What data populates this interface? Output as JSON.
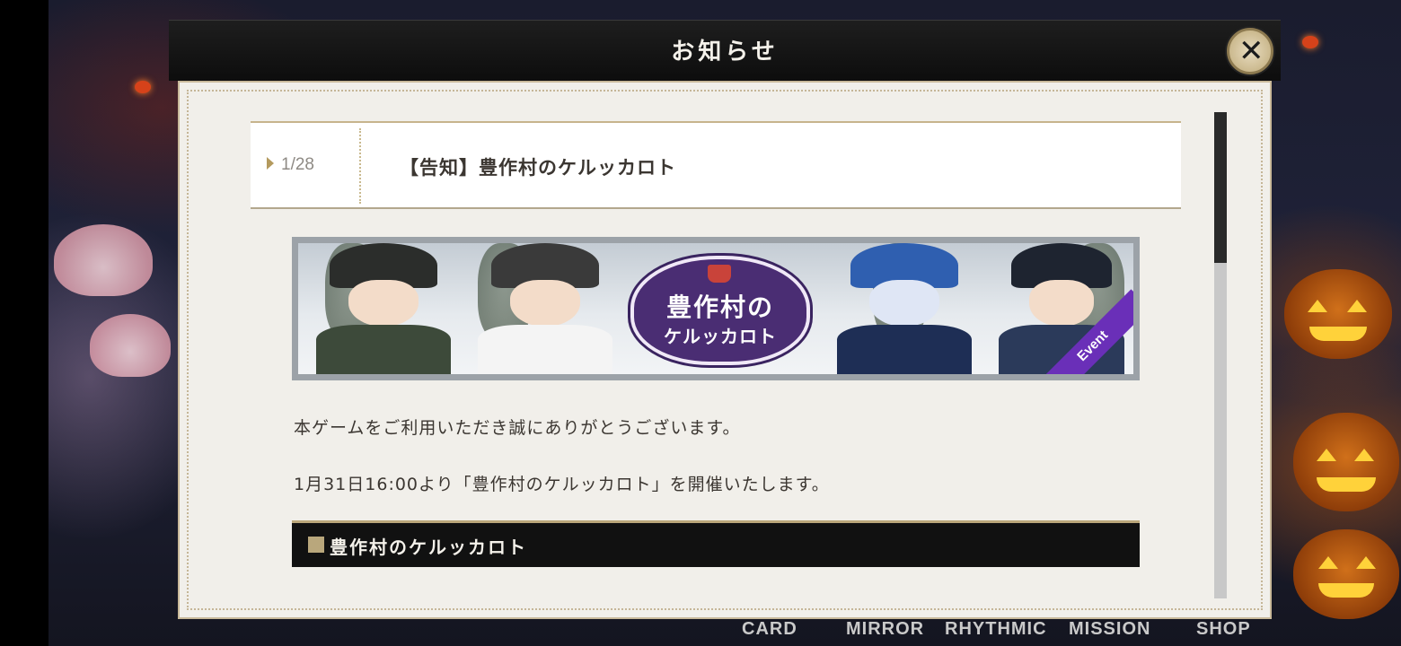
{
  "modal": {
    "title": "お知らせ",
    "close_icon": "close-icon"
  },
  "notice": {
    "date": "1/28",
    "title": "【告知】豊作村のケルッカロト"
  },
  "banner": {
    "logo_line1": "豊作村の",
    "logo_line2": "ケルッカロト",
    "ribbon": "Event"
  },
  "body": {
    "paragraph1": "本ゲームをご利用いただき誠にありがとうございます。",
    "paragraph2": "1月31日16:00より「豊作村のケルッカロト」を開催いたします。",
    "section_title": "豊作村のケルッカロト"
  },
  "bottom_nav": {
    "items": [
      "CARD",
      "MIRROR",
      "RHYTHMIC",
      "MISSION",
      "SHOP"
    ]
  },
  "colors": {
    "accent_gold": "#b9a77c",
    "header_bg": "#111111",
    "panel_bg": "#f1efea",
    "event_ribbon": "#6a2fb8"
  }
}
